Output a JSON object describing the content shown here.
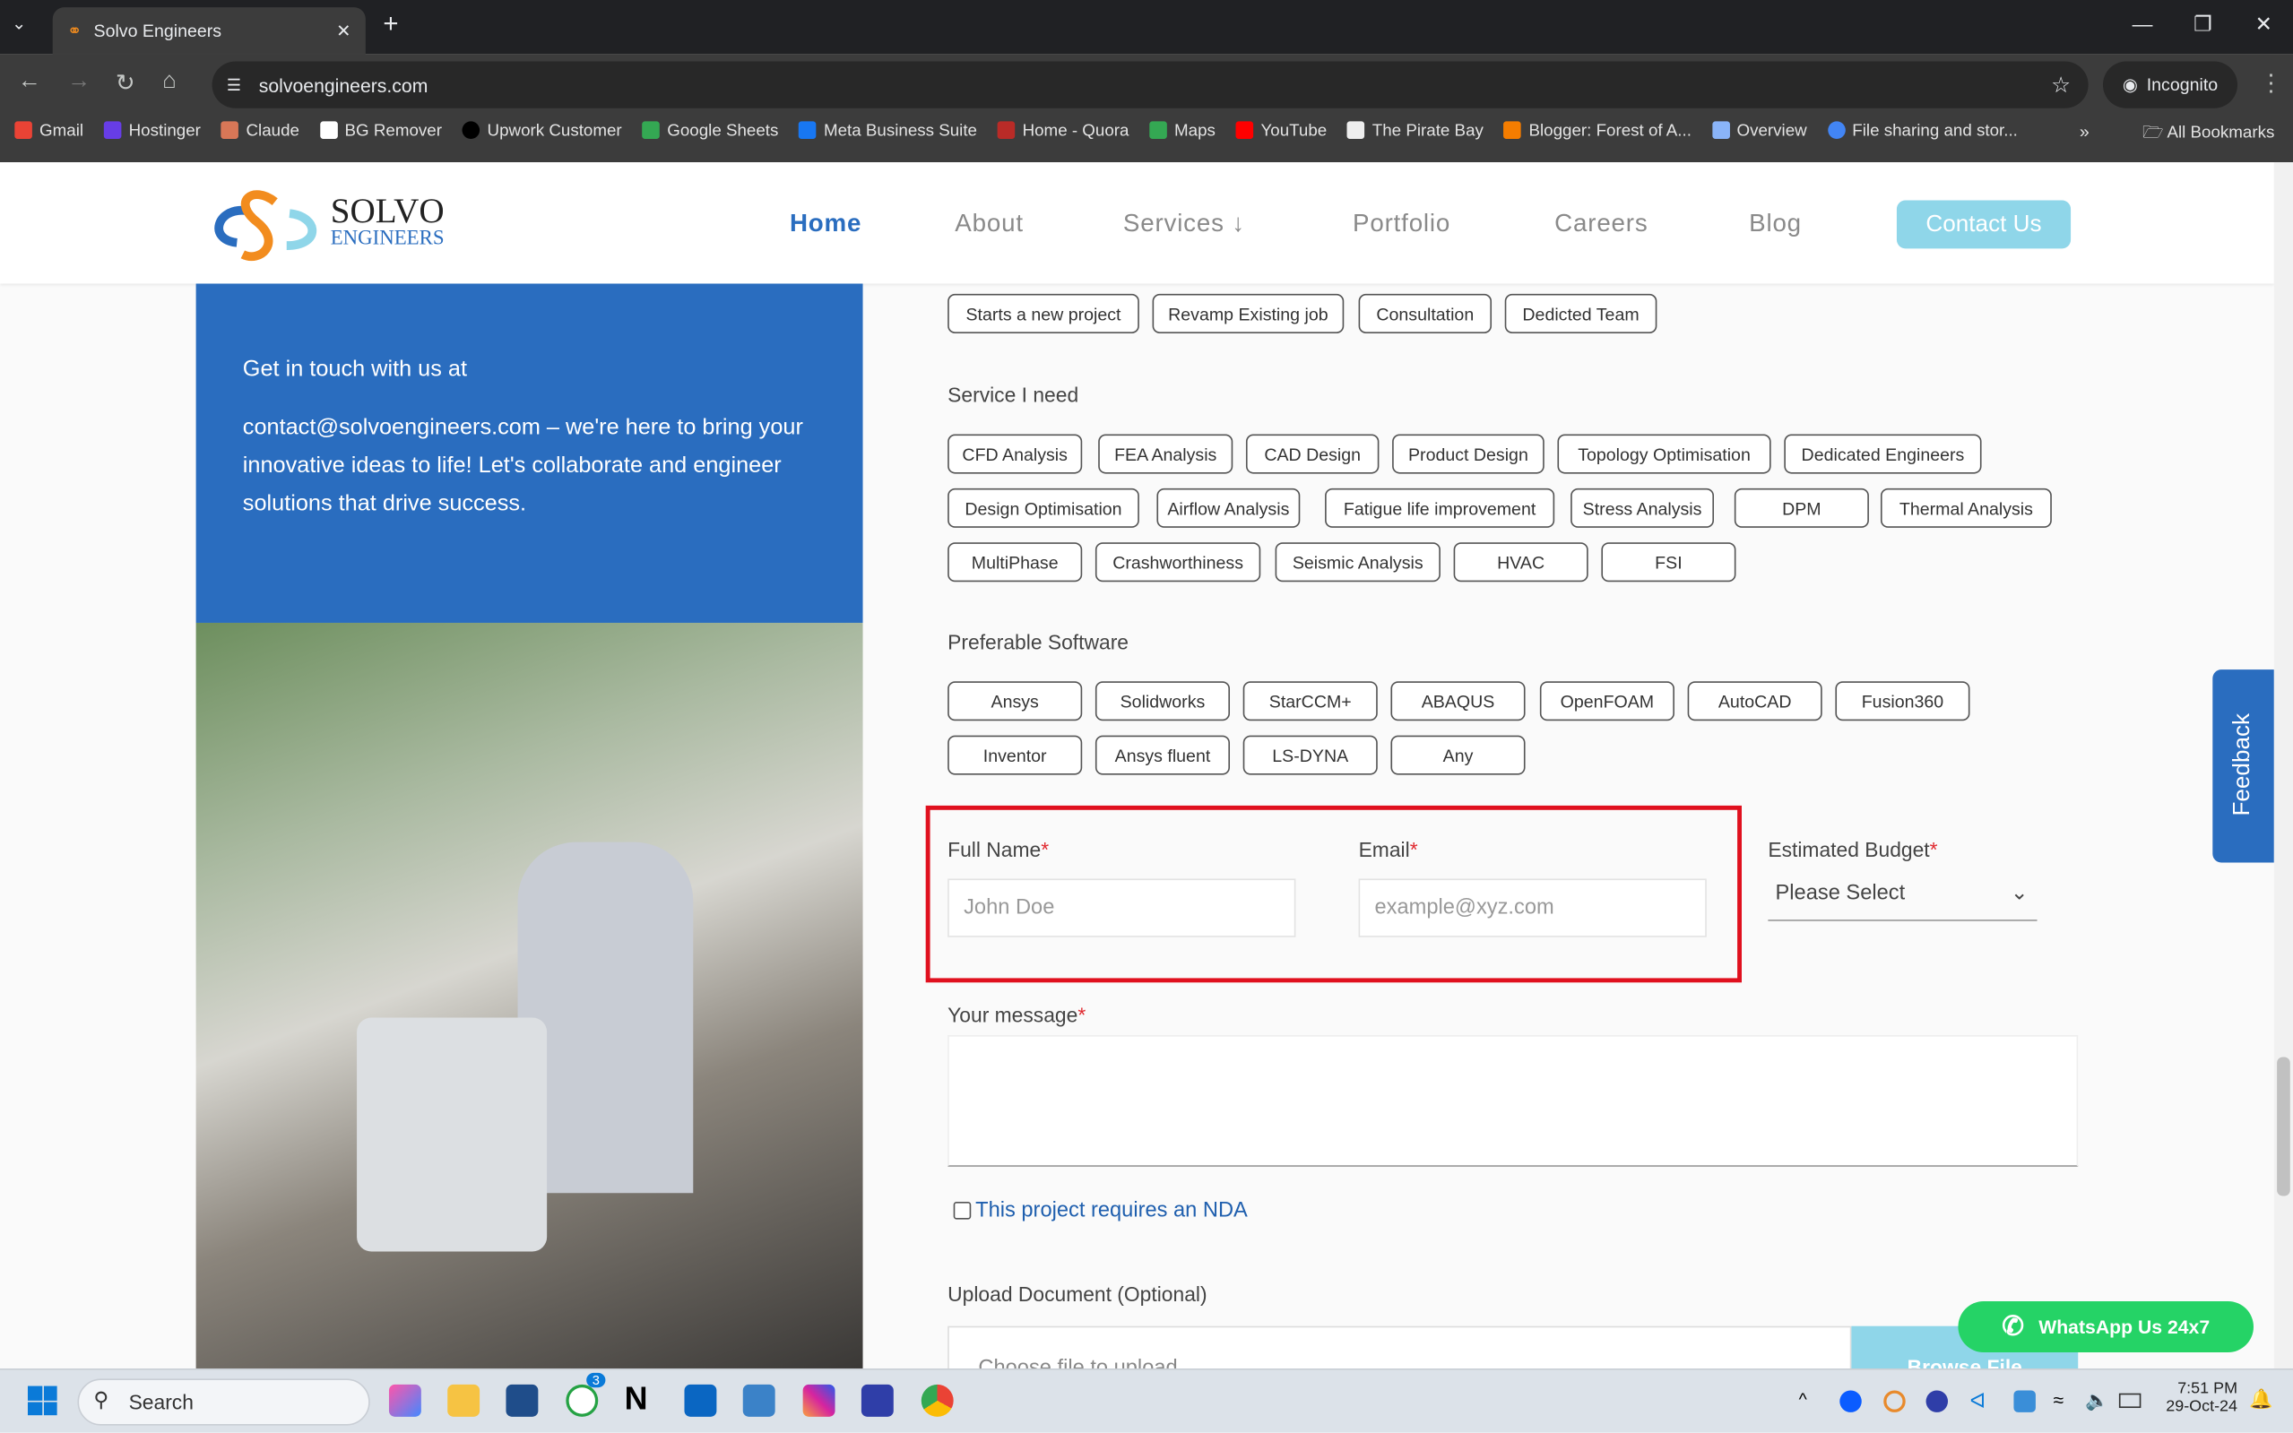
{
  "browser": {
    "tab_title": "Solvo Engineers",
    "url": "solvoengineers.com",
    "incognito": "Incognito",
    "bookmarks": [
      "Gmail",
      "Hostinger",
      "Claude",
      "BG Remover",
      "Upwork Customer",
      "Google Sheets",
      "Meta Business Suite",
      "Home - Quora",
      "Maps",
      "YouTube",
      "The Pirate Bay",
      "Blogger: Forest of A...",
      "Overview",
      "File sharing and stor..."
    ],
    "all_bookmarks": "All Bookmarks"
  },
  "site": {
    "logo_top": "SOLVO",
    "logo_bottom": "ENGINEERS",
    "menu": [
      "Home",
      "About",
      "Services ↓",
      "Portfolio",
      "Careers",
      "Blog"
    ],
    "contact_button": "Contact Us",
    "accent": "#2a6dbf"
  },
  "left_panel": {
    "heading": "Get in touch with us at",
    "body": "contact@solvoengineers.com – we're here to bring your innovative ideas to life! Let's collaborate and engineer solutions that drive success."
  },
  "form": {
    "project_types": [
      "Starts a new project",
      "Revamp Existing job",
      "Consultation",
      "Dedicted Team"
    ],
    "service_label": "Service I need",
    "services": [
      "CFD Analysis",
      "FEA Analysis",
      "CAD Design",
      "Product Design",
      "Topology Optimisation",
      "Dedicated Engineers",
      "Design Optimisation",
      "Airflow Analysis",
      "Fatigue life improvement",
      "Stress Analysis",
      "DPM",
      "Thermal Analysis",
      "MultiPhase",
      "Crashworthiness",
      "Seismic Analysis",
      "HVAC",
      "FSI"
    ],
    "software_label": "Preferable Software",
    "software": [
      "Ansys",
      "Solidworks",
      "StarCCM+",
      "ABAQUS",
      "OpenFOAM",
      "AutoCAD",
      "Fusion360",
      "Inventor",
      "Ansys fluent",
      "LS-DYNA",
      "Any"
    ],
    "full_name_label": "Full Name",
    "full_name_placeholder": "John Doe",
    "email_label": "Email",
    "email_placeholder": "example@xyz.com",
    "budget_label": "Estimated Budget",
    "budget_value": "Please Select",
    "message_label": "Your message",
    "required_mark": "*",
    "nda_label": "This project requires an NDA",
    "upload_label": "Upload Document (Optional)",
    "upload_placeholder": "Choose file to upload",
    "browse": "Browse File"
  },
  "feedback": "Feedback",
  "whatsapp": "WhatsApp Us 24x7",
  "taskbar": {
    "search": "Search",
    "time": "7:51 PM",
    "date": "29-Oct-24",
    "whatsapp_badge": "3"
  }
}
